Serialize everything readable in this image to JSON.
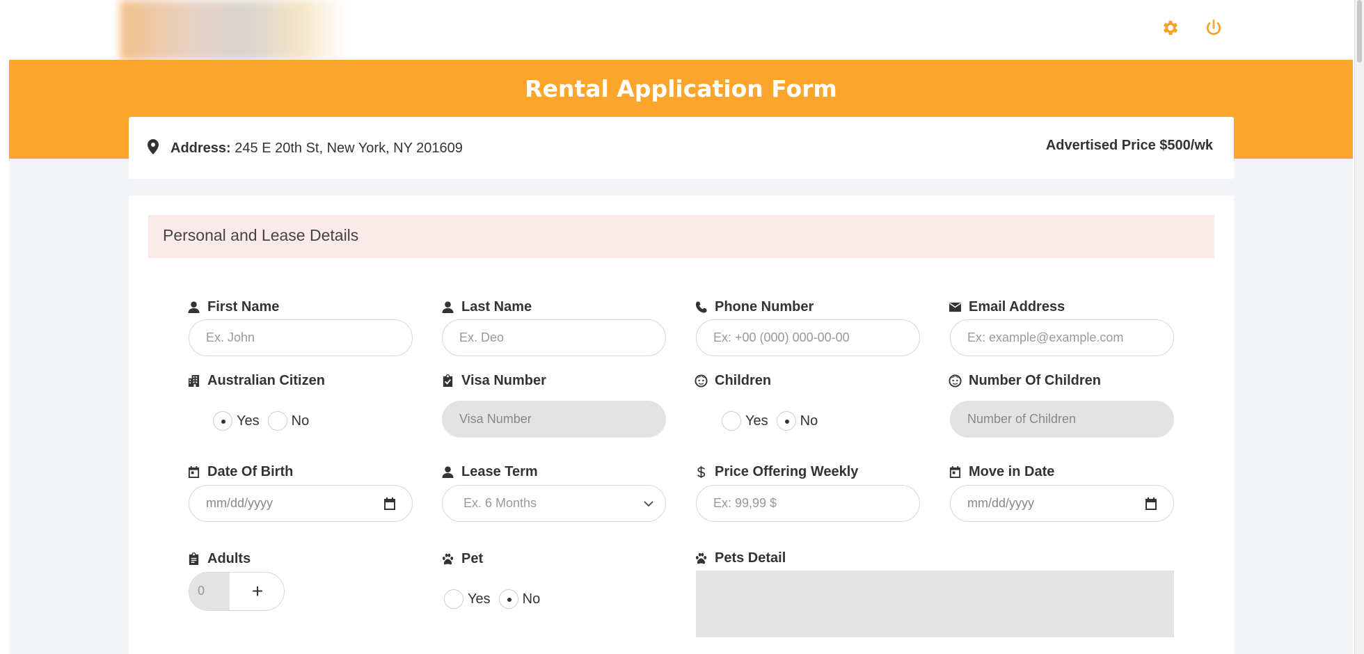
{
  "header": {
    "settings_icon": "gear-icon",
    "power_icon": "power-icon",
    "accent_color": "#fca52c"
  },
  "banner": {
    "title": "Rental Application Form"
  },
  "property": {
    "address_label": "Address:",
    "address_value": "245 E 20th St, New York, NY 201609",
    "price": "Advertised Price $500/wk"
  },
  "section": {
    "title": "Personal and Lease Details"
  },
  "fields": {
    "first_name": {
      "label": "First Name",
      "placeholder": "Ex. John",
      "icon": "user-icon"
    },
    "last_name": {
      "label": "Last Name",
      "placeholder": "Ex. Deo",
      "icon": "user-icon"
    },
    "phone": {
      "label": "Phone Number",
      "placeholder": "Ex: +00 (000) 000-00-00",
      "icon": "phone-icon"
    },
    "email": {
      "label": "Email Address",
      "placeholder": "Ex: example@example.com",
      "icon": "envelope-icon"
    },
    "citizen": {
      "label": "Australian Citizen",
      "icon": "building-icon",
      "yes": "Yes",
      "no": "No",
      "selected": "Yes"
    },
    "visa": {
      "label": "Visa Number",
      "placeholder": "Visa Number",
      "icon": "clipboard-check-icon",
      "disabled": true
    },
    "children": {
      "label": "Children",
      "icon": "child-face-icon",
      "yes": "Yes",
      "no": "No",
      "selected": "No"
    },
    "num_children": {
      "label": "Number Of Children",
      "placeholder": "Number of Children",
      "icon": "child-face-icon",
      "disabled": true
    },
    "dob": {
      "label": "Date Of Birth",
      "placeholder": "mm/dd/yyyy",
      "icon": "calendar-icon"
    },
    "lease_term": {
      "label": "Lease Term",
      "placeholder": "Ex. 6 Months",
      "icon": "user-icon"
    },
    "price_offer": {
      "label": "Price Offering Weekly",
      "placeholder": "Ex: 99,99 $",
      "icon": "dollar-icon"
    },
    "move_in": {
      "label": "Move in Date",
      "placeholder": "mm/dd/yyyy",
      "icon": "calendar-icon"
    },
    "adults": {
      "label": "Adults",
      "value": "0",
      "plus": "+",
      "icon": "clipboard-icon"
    },
    "pet": {
      "label": "Pet",
      "icon": "paw-icon",
      "yes": "Yes",
      "no": "No",
      "selected": "No"
    },
    "pets_detail": {
      "label": "Pets Detail",
      "icon": "paw-icon"
    }
  }
}
